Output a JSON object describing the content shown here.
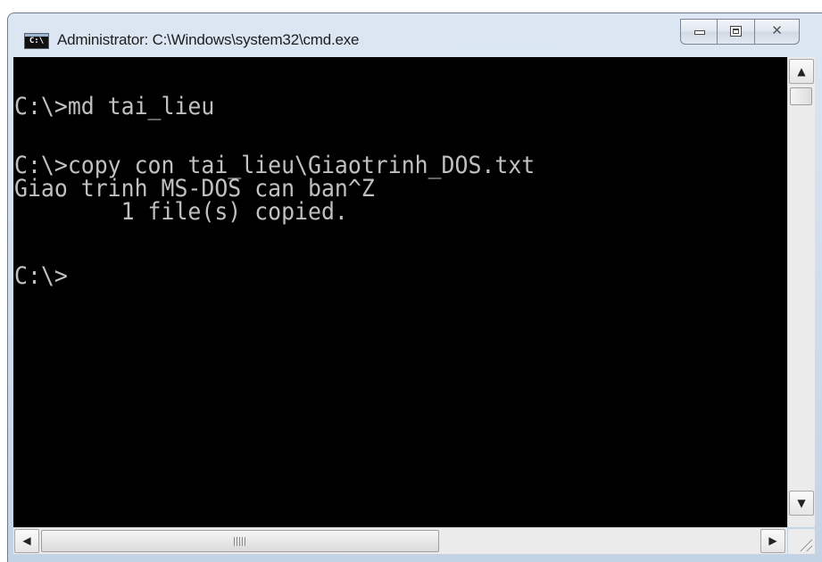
{
  "window": {
    "title": "Administrator: C:\\Windows\\system32\\cmd.exe",
    "icon_label": "C:\\",
    "icons": {
      "app": "cmd-icon",
      "minimize": "minimize-icon",
      "maximize": "maximize-icon",
      "close": "close-icon"
    },
    "close_glyph": "✕"
  },
  "console": {
    "text_color": "#c0c0c0",
    "background": "#000000",
    "lines": [
      "C:\\>md tai_lieu",
      "",
      "C:\\>copy con tai_lieu\\Giaotrinh_DOS.txt",
      "Giao trinh MS-DOS can ban^Z",
      "        1 file(s) copied.",
      "",
      "C:\\>"
    ]
  },
  "scrollbars": {
    "up_arrow": "▲",
    "down_arrow": "▼",
    "left_arrow": "◀",
    "right_arrow": "▶"
  }
}
